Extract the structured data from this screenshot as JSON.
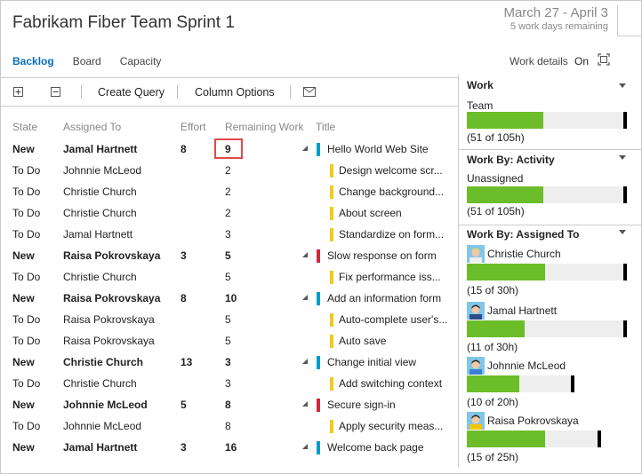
{
  "header": {
    "title": "Fabrikam Fiber Team Sprint 1",
    "date_range": "March 27 - April 3",
    "days_remaining": "5 work days remaining"
  },
  "tabs": [
    {
      "label": "Backlog",
      "active": true
    },
    {
      "label": "Board",
      "active": false
    },
    {
      "label": "Capacity",
      "active": false
    }
  ],
  "work_details": {
    "label": "Work details",
    "state": "On"
  },
  "toolbar": {
    "create_query": "Create Query",
    "column_options": "Column Options"
  },
  "columns": [
    "State",
    "Assigned To",
    "Effort",
    "Remaining Work",
    "Title"
  ],
  "rows": [
    {
      "state": "New",
      "assigned": "Jamal Hartnett",
      "effort": "8",
      "remaining": "9",
      "title": "Hello World Web Site",
      "parent": true,
      "color": "#009ccc"
    },
    {
      "state": "To Do",
      "assigned": "Johnnie McLeod",
      "effort": "",
      "remaining": "2",
      "title": "Design welcome scr...",
      "parent": false,
      "color": "#f2cb1d"
    },
    {
      "state": "To Do",
      "assigned": "Christie Church",
      "effort": "",
      "remaining": "2",
      "title": "Change background...",
      "parent": false,
      "color": "#f2cb1d"
    },
    {
      "state": "To Do",
      "assigned": "Christie Church",
      "effort": "",
      "remaining": "2",
      "title": "About screen",
      "parent": false,
      "color": "#f2cb1d"
    },
    {
      "state": "To Do",
      "assigned": "Jamal Hartnett",
      "effort": "",
      "remaining": "3",
      "title": "Standardize on form...",
      "parent": false,
      "color": "#f2cb1d"
    },
    {
      "state": "New",
      "assigned": "Raisa Pokrovskaya",
      "effort": "3",
      "remaining": "5",
      "title": "Slow response on form",
      "parent": true,
      "color": "#cc293d"
    },
    {
      "state": "To Do",
      "assigned": "Christie Church",
      "effort": "",
      "remaining": "5",
      "title": "Fix performance iss...",
      "parent": false,
      "color": "#f2cb1d"
    },
    {
      "state": "New",
      "assigned": "Raisa Pokrovskaya",
      "effort": "8",
      "remaining": "10",
      "title": "Add an information form",
      "parent": true,
      "color": "#009ccc"
    },
    {
      "state": "To Do",
      "assigned": "Raisa Pokrovskaya",
      "effort": "",
      "remaining": "5",
      "title": "Auto-complete user's...",
      "parent": false,
      "color": "#f2cb1d"
    },
    {
      "state": "To Do",
      "assigned": "Raisa Pokrovskaya",
      "effort": "",
      "remaining": "5",
      "title": "Auto save",
      "parent": false,
      "color": "#f2cb1d"
    },
    {
      "state": "New",
      "assigned": "Christie Church",
      "effort": "13",
      "remaining": "3",
      "title": "Change initial view",
      "parent": true,
      "color": "#009ccc"
    },
    {
      "state": "To Do",
      "assigned": "Christie Church",
      "effort": "",
      "remaining": "3",
      "title": "Add switching context",
      "parent": false,
      "color": "#f2cb1d"
    },
    {
      "state": "New",
      "assigned": "Johnnie McLeod",
      "effort": "5",
      "remaining": "8",
      "title": "Secure sign-in",
      "parent": true,
      "color": "#cc293d"
    },
    {
      "state": "To Do",
      "assigned": "Johnnie McLeod",
      "effort": "",
      "remaining": "8",
      "title": "Apply security meas...",
      "parent": false,
      "color": "#f2cb1d"
    },
    {
      "state": "New",
      "assigned": "Jamal Hartnett",
      "effort": "3",
      "remaining": "16",
      "title": "Welcome back page",
      "parent": true,
      "color": "#009ccc"
    }
  ],
  "panel": {
    "work": {
      "heading": "Work",
      "label": "Team",
      "count": "(51 of 105h)",
      "fill": 0.486
    },
    "by_activity": {
      "heading": "Work By: Activity",
      "label": "Unassigned",
      "count": "(51 of 105h)",
      "fill": 0.486
    },
    "by_assigned": {
      "heading": "Work By: Assigned To",
      "people": [
        {
          "name": "Christie Church",
          "count": "(15 of 30h)",
          "fill": 0.5,
          "capacity": 30
        },
        {
          "name": "Jamal Hartnett",
          "count": "(11 of 30h)",
          "fill": 0.367,
          "capacity": 30
        },
        {
          "name": "Johnnie McLeod",
          "count": "(10 of 20h)",
          "fill": 0.5,
          "capacity": 20
        },
        {
          "name": "Raisa Pokrovskaya",
          "count": "(15 of 25h)",
          "fill": 0.6,
          "capacity": 25
        }
      ]
    }
  },
  "colors": {
    "accent": "#0a6ebd",
    "bar_fill": "#6cbd2a",
    "highlight": "#e04848"
  }
}
